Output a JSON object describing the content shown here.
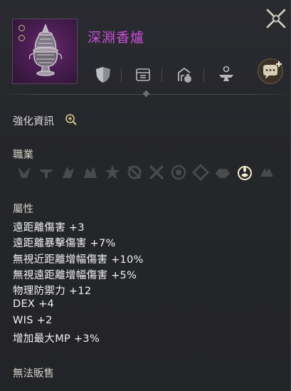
{
  "item": {
    "name": "深淵香爐",
    "name_color": "#c94fd9",
    "icon": "incense-burner-icon"
  },
  "toolbar": {
    "icons": [
      "shield-icon",
      "storage-icon",
      "trade-icon",
      "anvil-icon"
    ],
    "chat_icon": "chat-add-icon",
    "close_icon": "close-icon"
  },
  "enhance": {
    "label": "強化資訊",
    "icon": "magnify-plus-icon"
  },
  "classes": {
    "title": "職業",
    "icons": [
      "class-1-icon",
      "class-2-icon",
      "class-3-icon",
      "class-4-icon",
      "class-5-icon",
      "class-6-icon",
      "class-7-icon",
      "class-8-icon",
      "class-9-icon",
      "class-10-icon",
      "class-11-icon",
      "class-12-icon"
    ],
    "active_index": 10
  },
  "attributes": {
    "title": "屬性",
    "items": [
      "遠距離傷害 +3",
      "遠距離暴擊傷害 +7%",
      "無視近距離增幅傷害 +10%",
      "無視遠距離增幅傷害 +5%",
      "物理防禦力 +12",
      "DEX +4",
      "WIS +2",
      "增加最大MP +3%"
    ]
  },
  "footer": {
    "label": "無法販售"
  }
}
